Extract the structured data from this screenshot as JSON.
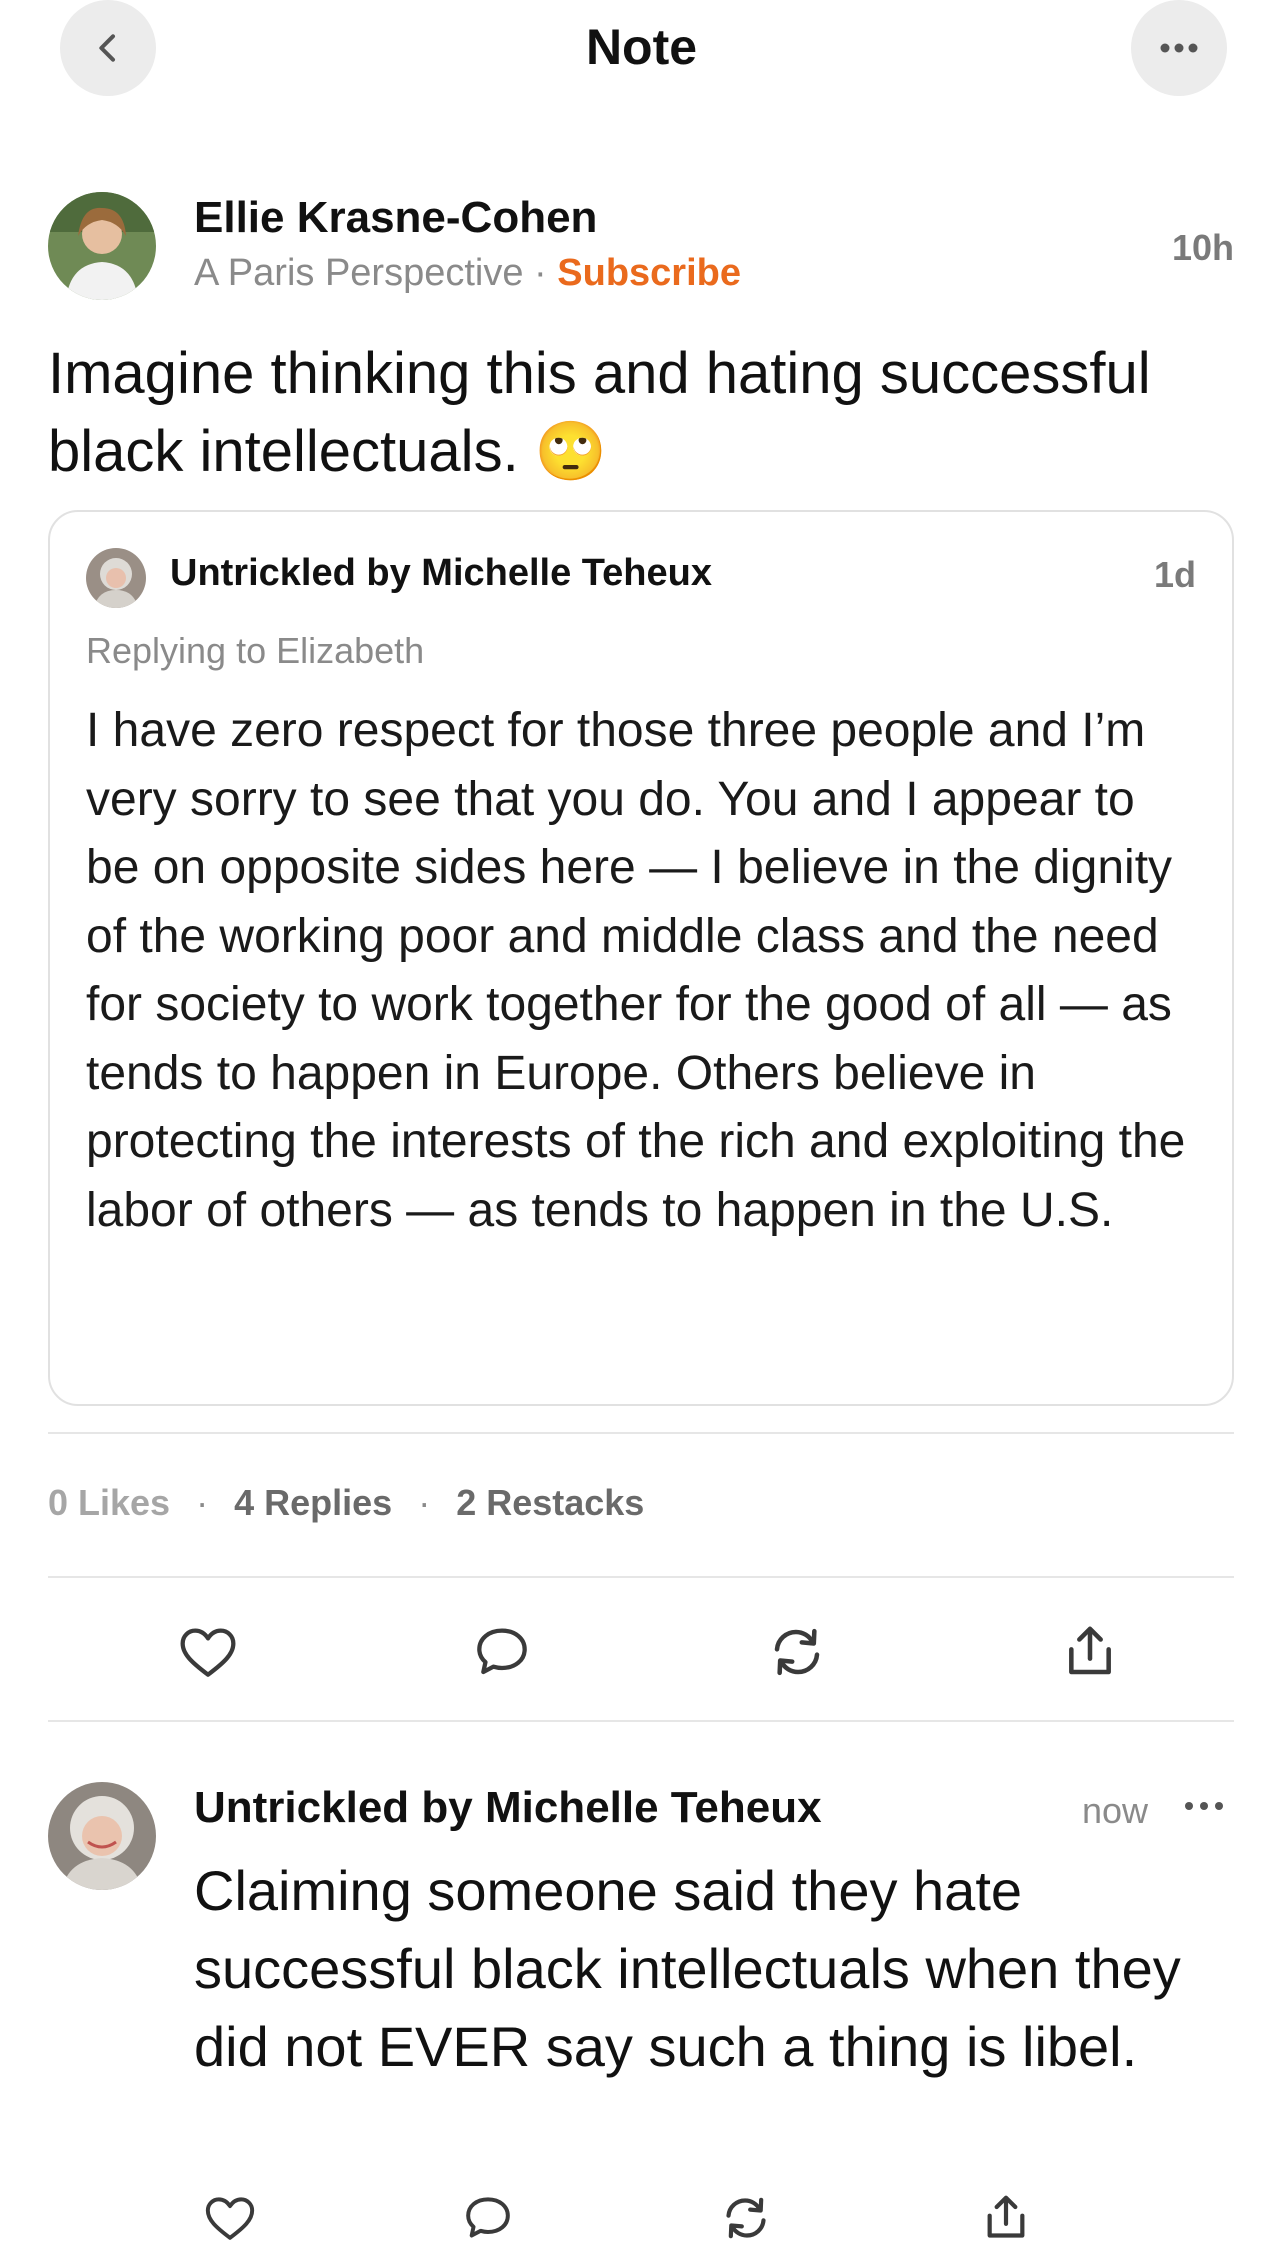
{
  "header": {
    "title": "Note",
    "back_icon": "chevron-left-icon",
    "more_icon": "more-horizontal-icon"
  },
  "note": {
    "author_name": "Ellie Krasne-Cohen",
    "publication": "A Paris Perspective",
    "separator": "·",
    "subscribe_label": "Subscribe",
    "time": "10h",
    "text": "Imagine thinking this and hating successful black intellectuals.",
    "emoji": "🙄"
  },
  "quoted": {
    "author_name": "Untrickled by Michelle Teheux",
    "time": "1d",
    "replying_to": "Replying to Elizabeth",
    "text": "I have zero respect for those three people and I’m very sorry to see that you do. You and I appear to be on opposite sides here — I believe in the dignity of the working poor and middle class and the need for society to work together for the good of all — as tends to happen in Europe. Others believe in protecting the interests of the rich and exploiting the labor of others — as tends to happen in the U.S."
  },
  "stats": {
    "likes": "0 Likes",
    "replies": "4 Replies",
    "restacks": "2 Restacks",
    "separator": "·"
  },
  "actions": [
    "heart-icon",
    "comment-icon",
    "restack-icon",
    "share-icon"
  ],
  "reply": {
    "author_name": "Untrickled by Michelle Teheux",
    "time": "now",
    "text": "Claiming someone said they hate successful black intellectuals when they did not EVER say such a thing is libel."
  },
  "colors": {
    "accent": "#ea6a1d",
    "text": "#111111",
    "muted": "#8a8a8a",
    "divider": "#e6e6e6"
  }
}
